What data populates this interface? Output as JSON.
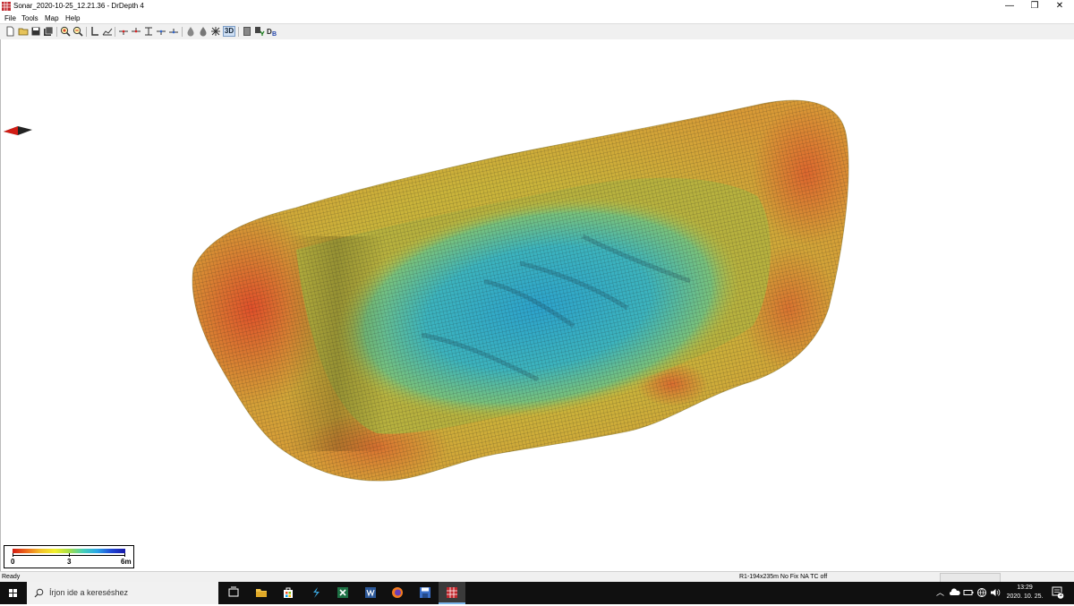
{
  "window": {
    "title": "Sonar_2020-10-25_12.21.36 - DrDepth 4",
    "controls": {
      "minimize": "—",
      "restore": "❐",
      "close": "✕"
    }
  },
  "menu": {
    "file": "File",
    "tools": "Tools",
    "map": "Map",
    "help": "Help"
  },
  "toolbar": {
    "buttons": [
      "new-icon",
      "open-icon",
      "save-icon",
      "save-all-icon",
      "zoom-in-icon",
      "zoom-out-icon",
      "ruler-l-icon",
      "profile-icon",
      "marker-1-icon",
      "marker-2-icon",
      "marker-3-icon",
      "marker-4-icon",
      "marker-5-icon",
      "drop-1-icon",
      "drop-2-icon",
      "grid-icon",
      "3d-icon",
      "layers-icon",
      "depth-y-icon",
      "db-icon"
    ],
    "view_3d_label": "3D",
    "active": "3d-icon"
  },
  "legend": {
    "labels": {
      "min": "0",
      "mid": "3",
      "max": "6m"
    },
    "colors": [
      "#d21c14",
      "#ef6b1c",
      "#f3c22a",
      "#f2ef2c",
      "#a6dd45",
      "#46cfb6",
      "#2aa6e6",
      "#1f48d6",
      "#1818a8"
    ]
  },
  "status": {
    "ready": "Ready",
    "info": "R1-194x235m  No Fix    NA  TC off"
  },
  "taskbar": {
    "search_placeholder": "Írjon ide a kereséshez",
    "apps": [
      "task-view-icon",
      "file-explorer-icon",
      "store-icon",
      "sway-icon",
      "excel-icon",
      "word-icon",
      "firefox-icon",
      "save-app-icon",
      "drdepth-icon"
    ],
    "active_app": "drdepth-icon",
    "time": "13:29",
    "date": "2020. 10. 25.",
    "notification_count": "2"
  },
  "colors": {
    "taskbar_bg": "#101010",
    "depth_shallow": "#d8452a",
    "depth_mid": "#c9b33a",
    "depth_deep": "#2fa8c6"
  }
}
